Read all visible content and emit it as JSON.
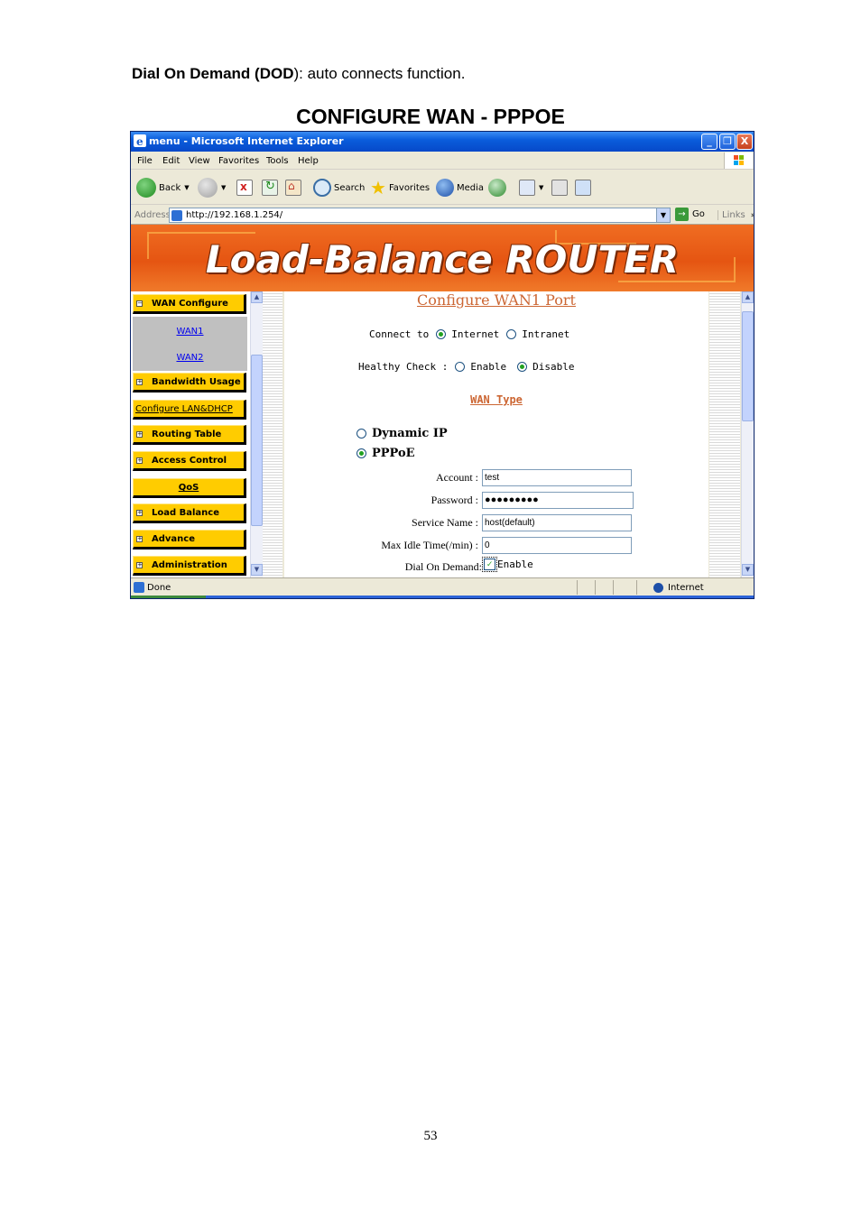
{
  "doc": {
    "intro_bold1": "Dial On Demand (",
    "intro_bold2": "DOD",
    "intro_rest": "): auto connects function.",
    "heading": "CONFIGURE WAN - PPPOE",
    "page_number": "53"
  },
  "window": {
    "title": "menu - Microsoft Internet Explorer",
    "minimize": "_",
    "restore": "❐",
    "close": "X"
  },
  "menu": {
    "items": [
      "File",
      "Edit",
      "View",
      "Favorites",
      "Tools",
      "Help"
    ]
  },
  "toolbar": {
    "back": "Back",
    "search": "Search",
    "favorites": "Favorites",
    "media": "Media"
  },
  "address": {
    "label": "Address",
    "url": "http://192.168.1.254/",
    "go": "Go",
    "links": "Links"
  },
  "banner": {
    "title": "Load-Balance ROUTER"
  },
  "nav": {
    "wan_configure": "WAN Configure",
    "wan1": "WAN1",
    "wan2": "WAN2",
    "bandwidth_usage": "Bandwidth Usage",
    "configure_lan_dhcp": "Configure LAN&DHCP",
    "routing_table": "Routing Table",
    "access_control": "Access Control",
    "qos": "QoS",
    "load_balance": "Load Balance",
    "advance": "Advance",
    "administration": "Administration"
  },
  "form": {
    "title": "Configure WAN1 Port",
    "connect_to_label": "Connect to",
    "connect_internet": "Internet",
    "connect_intranet": "Intranet",
    "connect_selected": "Internet",
    "healthy_check_label": "Healthy Check :",
    "healthy_enable": "Enable",
    "healthy_disable": "Disable",
    "healthy_selected": "Disable",
    "wan_type_label": "WAN Type",
    "dynamic_ip": "Dynamic IP",
    "pppoe": "PPPoE",
    "wan_type_selected": "PPPoE",
    "account_label": "Account :",
    "account_value": "test",
    "password_label": "Password :",
    "password_value": "●●●●●●●●●",
    "service_name_label": "Service Name :",
    "service_name_value": "host(default)",
    "max_idle_label": "Max Idle Time(/min) :",
    "max_idle_value": "0",
    "dial_on_demand_label": "Dial On Demand:",
    "dial_on_demand_option": "Enable",
    "dial_on_demand_checked": true
  },
  "status": {
    "done": "Done",
    "zone": "Internet"
  },
  "colors": {
    "nav_button": "#ffcc00",
    "banner": "#e55512",
    "form_title": "#cc6633",
    "titlebar": "#0a5ddc"
  }
}
